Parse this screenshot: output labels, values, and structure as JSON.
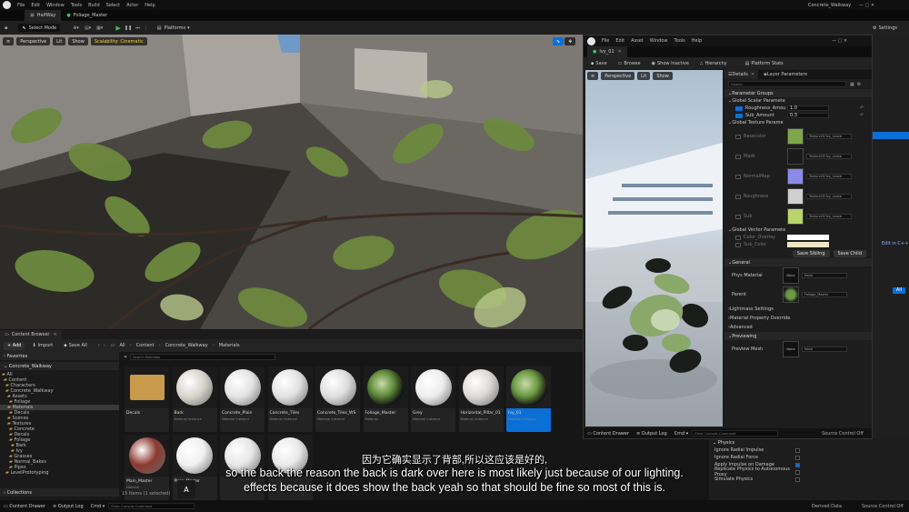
{
  "menu": [
    "File",
    "Edit",
    "Window",
    "Tools",
    "Build",
    "Select",
    "Actor",
    "Help"
  ],
  "project_name": "Concrete_Walkway",
  "tabs": [
    "HalfWay",
    "Foliage_Master"
  ],
  "toolbar": {
    "mode": "Select Mode",
    "platforms": "Platforms",
    "settings": "Settings"
  },
  "viewport": {
    "perspective": "Perspective",
    "lit": "Lit",
    "show": "Show",
    "scalability": "Scalability: Cinematic"
  },
  "content_browser": {
    "tab": "Content Browser",
    "add": "+ Add",
    "import": "Import",
    "save_all": "Save All",
    "path": [
      "All",
      "Content",
      "Concrete_Walkway",
      "Materials"
    ],
    "search_placeholder": "Search Materials",
    "favorites": "Favorites",
    "root": "Concrete_Walkway",
    "tree": [
      "All",
      "Content",
      "Characters",
      "Concrete_Walkway",
      "Assets",
      "Foliage",
      "Materials",
      "Decals",
      "Scenes",
      "Textures",
      "Concrete",
      "Decals",
      "Foliage",
      "Bark",
      "Ivy",
      "Grasses",
      "Normal_Bakes",
      "Pipes",
      "LevelPrototyping"
    ],
    "collections": "Collections",
    "count": "15 Items (1 selected)",
    "items": [
      {
        "name": "Decals",
        "type": "",
        "kind": "folder"
      },
      {
        "name": "Bark",
        "type": "Material Instance",
        "kind": "sphere",
        "color": "#d8d4cc"
      },
      {
        "name": "Concrete_Plain",
        "type": "Material Instance",
        "kind": "sphere",
        "color": "#e4e4e4"
      },
      {
        "name": "Concrete_Tiles",
        "type": "Material Instance",
        "kind": "sphere",
        "color": "#e2e2e2"
      },
      {
        "name": "Concrete_Tiles_WS",
        "type": "Material Instance",
        "kind": "sphere",
        "color": "#dedede"
      },
      {
        "name": "Foliage_Master",
        "type": "Material",
        "kind": "leaf",
        "color": "#5f8a3a"
      },
      {
        "name": "Grey",
        "type": "Material Instance",
        "kind": "sphere",
        "color": "#ededed"
      },
      {
        "name": "Horizontal_Pillar_01",
        "type": "Material Instance",
        "kind": "sphere",
        "color": "#dcdad6"
      },
      {
        "name": "Ivy_01",
        "type": "Material Instance",
        "kind": "leaf",
        "color": "#6b9a42"
      },
      {
        "name": "Main_Master",
        "type": "Material",
        "kind": "sphere",
        "color": "#8a3a30"
      },
      {
        "name": "Plain_Master",
        "type": "",
        "kind": "sphere",
        "color": "#f0f0f0"
      },
      {
        "name": "",
        "type": "",
        "kind": "sphere",
        "color": "#e6e6e6"
      },
      {
        "name": "",
        "type": "",
        "kind": "sphere",
        "color": "#e9e9e9"
      }
    ]
  },
  "status_bar": {
    "content_drawer": "Content Drawer",
    "output_log": "Output Log",
    "cmd": "Cmd",
    "console": "Enter Console Command",
    "derived": "Derived Data",
    "source": "Source Control Off"
  },
  "material_editor": {
    "menu": [
      "File",
      "Edit",
      "Asset",
      "Window",
      "Tools",
      "Help"
    ],
    "tab": "Ivy_01",
    "toolbar": [
      "Save",
      "Browse",
      "Show Inactive",
      "Hierarchy",
      "Platform Stats"
    ],
    "viewport": {
      "perspective": "Perspective",
      "lit": "Lit",
      "show": "Show"
    },
    "details_tab": "Details",
    "layer_tab": "Layer Parameters",
    "search_placeholder": "Search",
    "param_groups": "Parameter Groups",
    "global_scalar": "Global Scalar Paramete",
    "scalars": [
      {
        "name": "Roughness_Amou",
        "value": "1.0"
      },
      {
        "name": "Sub_Amount",
        "value": "0.3"
      }
    ],
    "global_texture": "Global Texture Parame",
    "textures": [
      {
        "name": "Basecolor",
        "value": "Texture2D'Ivy_Leave",
        "color": "#7fa64a"
      },
      {
        "name": "Mask",
        "value": "Texture2D'Ivy_Leave",
        "color": "#1a1a1a"
      },
      {
        "name": "NormalMap",
        "value": "Texture2D'Ivy_Leave",
        "color": "#8a8ae8"
      },
      {
        "name": "Roughness",
        "value": "Texture2D'Ivy_Leave",
        "color": "#cfcfcf"
      },
      {
        "name": "Sub",
        "value": "Texture2D'Ivy_Leave",
        "color": "#b8d46a"
      }
    ],
    "global_vector": "Global Vector Paramete",
    "vectors": [
      {
        "name": "Color_Overlay",
        "color": "#ffffff"
      },
      {
        "name": "Sub_Color",
        "color": "#efe6c6"
      }
    ],
    "save_sibling": "Save Sibling",
    "save_child": "Save Child",
    "general": "General",
    "phys_material": "Phys Material",
    "phys_value": "None",
    "parent": "Parent",
    "parent_value": "Foliage_Master",
    "collapsed": [
      "Lightmass Settings",
      "Material Property Override",
      "Advanced"
    ],
    "previewing": "Previewing",
    "preview_mesh": "Preview Mesh",
    "preview_value": "None",
    "status": {
      "content_drawer": "Content Drawer",
      "output_log": "Output Log",
      "cmd": "Cmd",
      "console": "Enter Console Command",
      "source": "Source Control Off"
    }
  },
  "right_panel": {
    "physics": "Physics",
    "rows": [
      "Ignore Radial Impulse",
      "Ignore Radial Force",
      "Apply Impulse on Damage",
      "Replicate Physics to Autonomous Proxy",
      "Simulate Physics"
    ]
  },
  "subtitles": {
    "chinese": "因为它确实显示了背部,所以这应该是好的,",
    "line1": "so the back the reason the back is dark over here is most likely just because of our lighting.",
    "line2": "effects because it does show the back yeah so that should be fine so most of this is.",
    "badge": "A"
  }
}
